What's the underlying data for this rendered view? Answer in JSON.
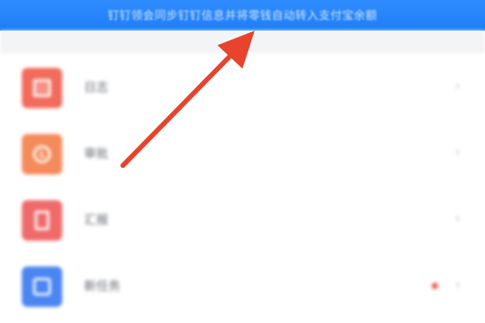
{
  "notice": {
    "text": "钉钉领会同步钉钉信息并将零钱自动转入支付宝余额"
  },
  "menu": {
    "items": [
      {
        "label": "日志",
        "icon": "doc-icon",
        "color": "#f26b5b",
        "chevron": "›",
        "badge": false
      },
      {
        "label": "审批",
        "icon": "clock-icon",
        "color": "#f58a5a",
        "chevron": "›",
        "badge": false
      },
      {
        "label": "汇报",
        "icon": "sheet-icon",
        "color": "#ef6a6a",
        "chevron": "›",
        "badge": false
      },
      {
        "label": "新任务",
        "icon": "square-icon",
        "color": "#4a85f2",
        "chevron": "›",
        "badge": true
      }
    ]
  },
  "annotation": {
    "arrow_color": "#e8432c"
  },
  "colors": {
    "notice_bar": "#2a87fb"
  }
}
